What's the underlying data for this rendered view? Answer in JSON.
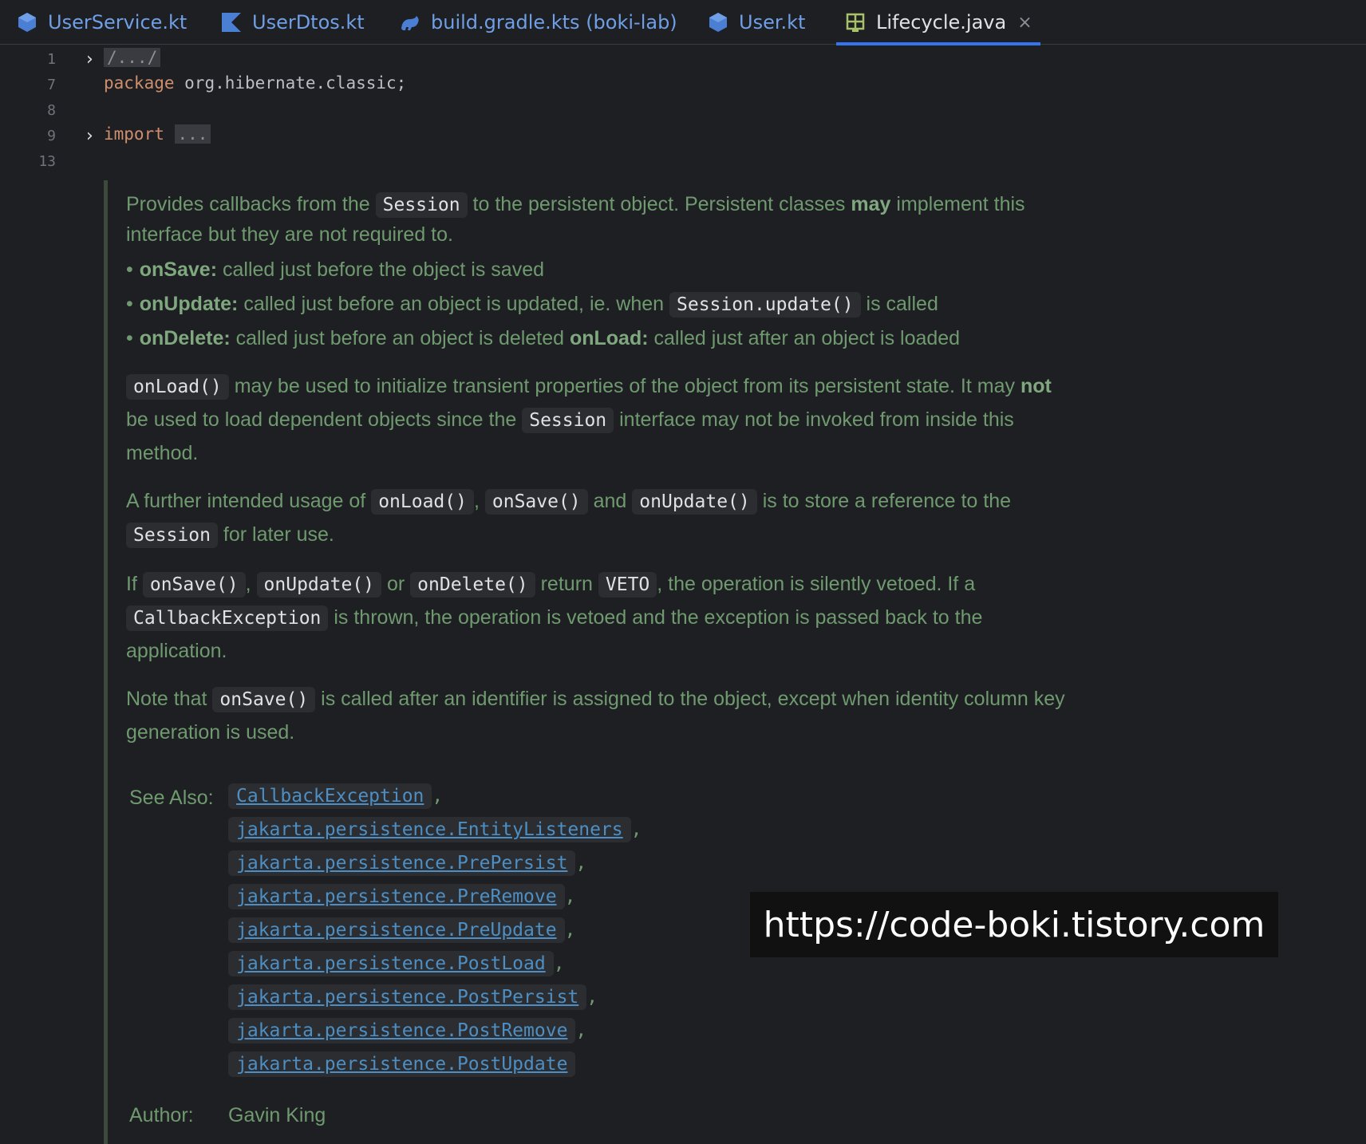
{
  "tabs": [
    {
      "label": "UserService.kt",
      "icon": "kotlin-class-icon"
    },
    {
      "label": "UserDtos.kt",
      "icon": "kotlin-file-icon"
    },
    {
      "label": "build.gradle.kts (boki-lab)",
      "icon": "gradle-icon"
    },
    {
      "label": "User.kt",
      "icon": "kotlin-class-icon"
    },
    {
      "label": "Lifecycle.java",
      "icon": "java-interface-icon",
      "active": true,
      "close": "×"
    }
  ],
  "gutter": {
    "lines": [
      "1",
      "7",
      "8",
      "9",
      "13"
    ]
  },
  "code": {
    "line1": "/.../",
    "package_kw": "package",
    "package_name": " org.hibernate.classic;",
    "import_kw": "import",
    "import_fold": "..."
  },
  "doc": {
    "p1_a": "Provides callbacks from the",
    "p1_code": "Session",
    "p1_b": "to the persistent object. Persistent classes",
    "p1_bold": "may",
    "p1_c": "implement this",
    "p1_line2": "interface but they are not required to.",
    "b1_bold": "onSave:",
    "b1_text": "called just before the object is saved",
    "b2_bold": "onUpdate:",
    "b2_text": "called just before an object is updated, ie. when",
    "b2_code": "Session.update()",
    "b2_text2": "is called",
    "b3_bold": "onDelete:",
    "b3_text": "called just before an object is deleted",
    "b3_bold2": "onLoad:",
    "b3_text2": "called just after an object is loaded",
    "p2_code": "onLoad()",
    "p2_a": "may be used to initialize transient properties of the object from its persistent state. It may",
    "p2_bold": "not",
    "p2_b": "be used to load dependent objects since the",
    "p2_code2": "Session",
    "p2_c": "interface may not be invoked from inside this",
    "p2_d": "method.",
    "p3_a": "A further intended usage of",
    "p3_code1": "onLoad()",
    "p3_code2": "onSave()",
    "p3_and": "and",
    "p3_code3": "onUpdate()",
    "p3_b": "is to store a reference to the",
    "p3_code4": "Session",
    "p3_c": "for later use.",
    "p4_if": "If",
    "p4_code1": "onSave()",
    "p4_code2": "onUpdate()",
    "p4_or": "or",
    "p4_code3": "onDelete()",
    "p4_return": "return",
    "p4_code4": "VETO",
    "p4_a": ", the operation is silently vetoed. If a",
    "p4_code5": "CallbackException",
    "p4_b": "is thrown, the operation is vetoed and the exception is passed back to the",
    "p4_c": "application.",
    "p5_a": "Note that",
    "p5_code": "onSave()",
    "p5_b": "is called after an identifier is assigned to the object, except when identity column key",
    "p5_c": "generation is used."
  },
  "see_also": {
    "label": "See Also:",
    "links": [
      "CallbackException",
      "jakarta.persistence.EntityListeners",
      "jakarta.persistence.PrePersist",
      "jakarta.persistence.PreRemove",
      "jakarta.persistence.PreUpdate",
      "jakarta.persistence.PostLoad",
      "jakarta.persistence.PostPersist",
      "jakarta.persistence.PostRemove",
      "jakarta.persistence.PostUpdate"
    ],
    "comma": ","
  },
  "author": {
    "label": "Author:",
    "value": "Gavin King"
  },
  "watermark": "https://code-boki.tistory.com",
  "colors": {
    "accent": "#3574f0",
    "doc_text": "#6f9a6f",
    "link": "#4d8fc4",
    "keyword": "#cf8e6d"
  }
}
